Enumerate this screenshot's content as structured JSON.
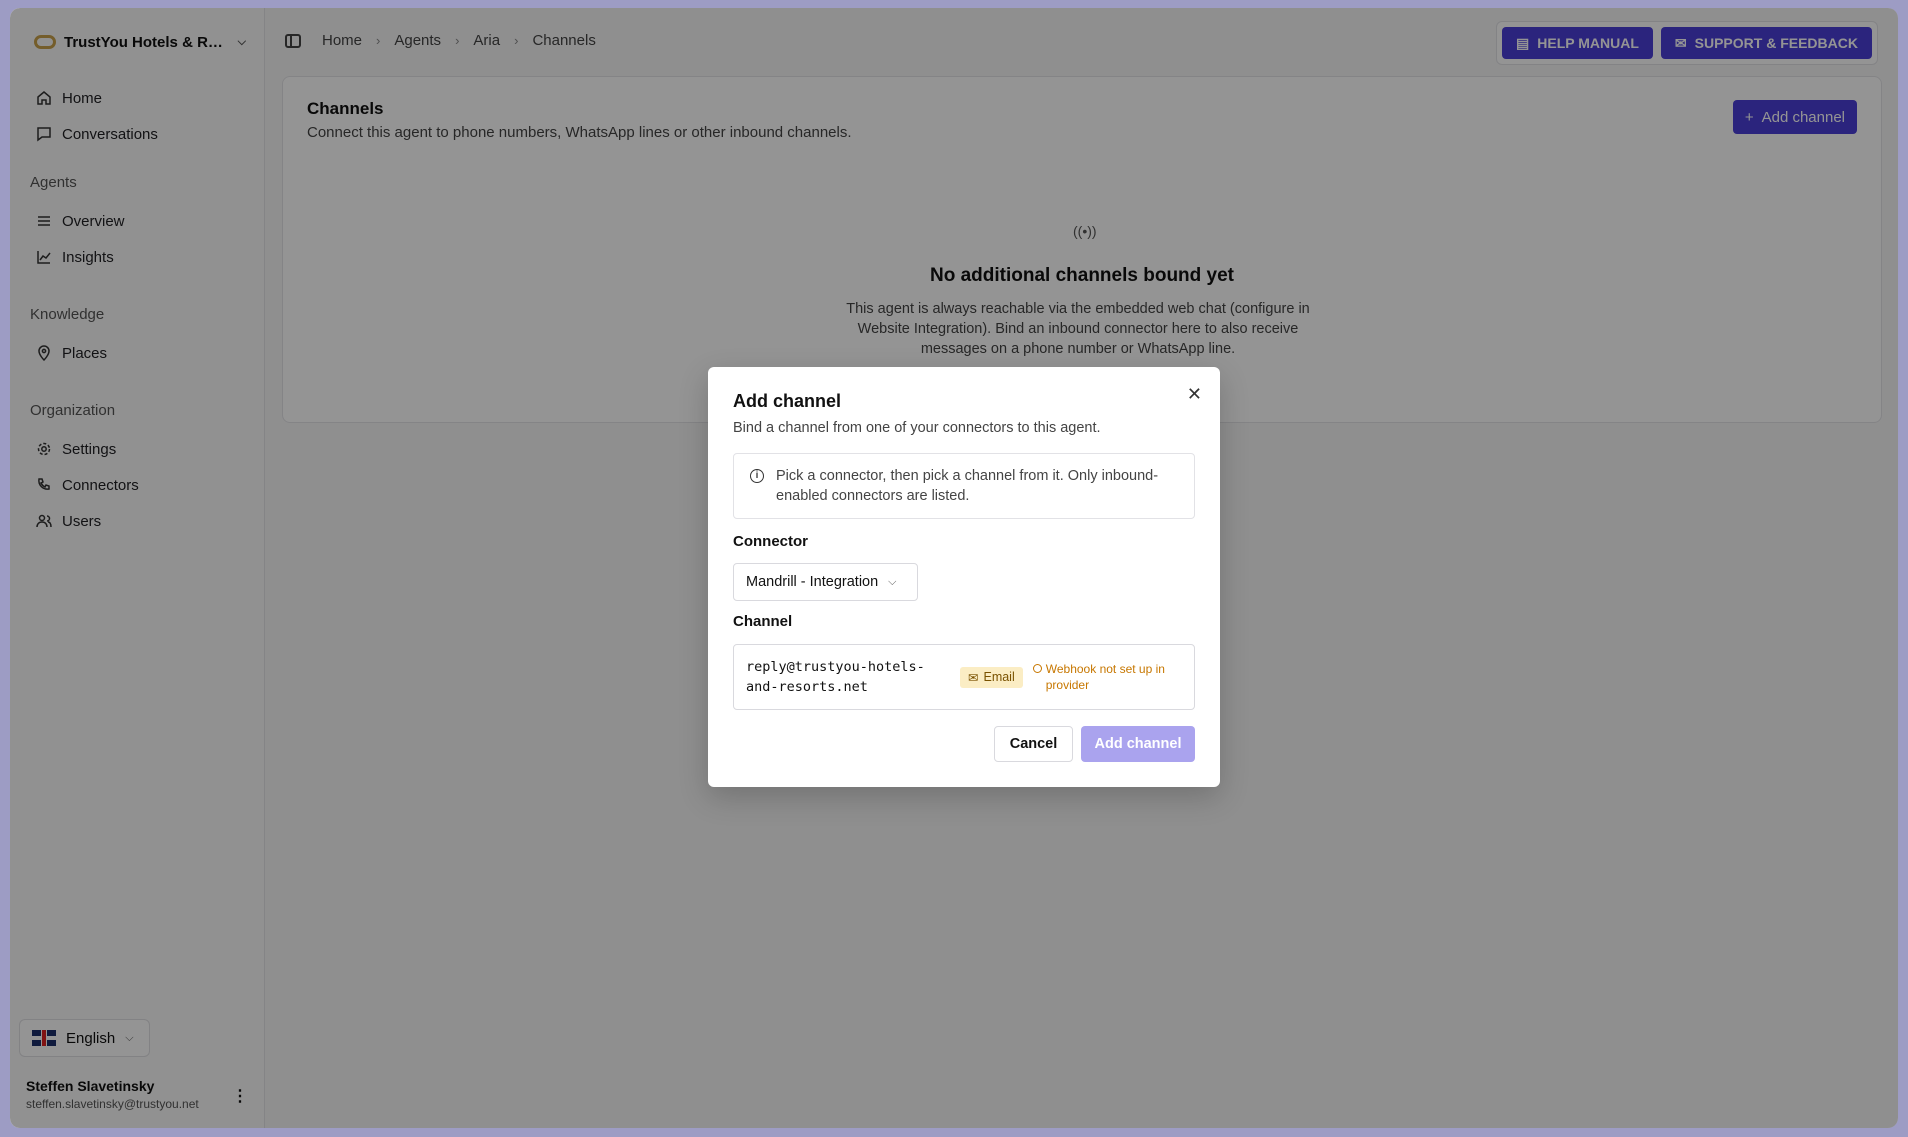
{
  "org": {
    "name": "TrustYou Hotels & Resorts"
  },
  "nav": {
    "home": "Home",
    "conversations": "Conversations",
    "agents_label": "Agents",
    "overview": "Overview",
    "insights": "Insights",
    "knowledge_label": "Knowledge",
    "places": "Places",
    "organization_label": "Organization",
    "settings": "Settings",
    "connectors": "Connectors",
    "users": "Users"
  },
  "language": {
    "selected": "English"
  },
  "user": {
    "name": "Steffen Slavetinsky",
    "email": "steffen.slavetinsky@trustyou.net"
  },
  "breadcrumb": [
    "Home",
    "Agents",
    "Aria",
    "Channels"
  ],
  "header": {
    "help_label": "HELP MANUAL",
    "support_label": "SUPPORT & FEEDBACK"
  },
  "page": {
    "title": "Channels",
    "subtitle": "Connect this agent to phone numbers, WhatsApp lines or other inbound channels.",
    "add_label": "Add channel",
    "empty_title": "No additional channels bound yet",
    "empty_text": "This agent is always reachable via the embedded web chat (configure in Website Integration). Bind an inbound connector here to also receive messages on a phone number or WhatsApp line."
  },
  "modal": {
    "title": "Add channel",
    "subtitle": "Bind a channel from one of your connectors to this agent.",
    "info": "Pick a connector, then pick a channel from it. Only inbound-enabled connectors are listed.",
    "connector_label": "Connector",
    "connector_value": "Mandrill - Integration",
    "channel_label": "Channel",
    "channel_address": "reply@trustyou-hotels-and-resorts.net",
    "channel_type": "Email",
    "channel_warning": "Webhook not set up in provider",
    "cancel_label": "Cancel",
    "add_label": "Add channel"
  },
  "colors": {
    "accent": "#4b3ed8",
    "accent_disabled": "#aaa3ee",
    "warning": "#c77700",
    "badge_bg": "#fbedc4"
  }
}
